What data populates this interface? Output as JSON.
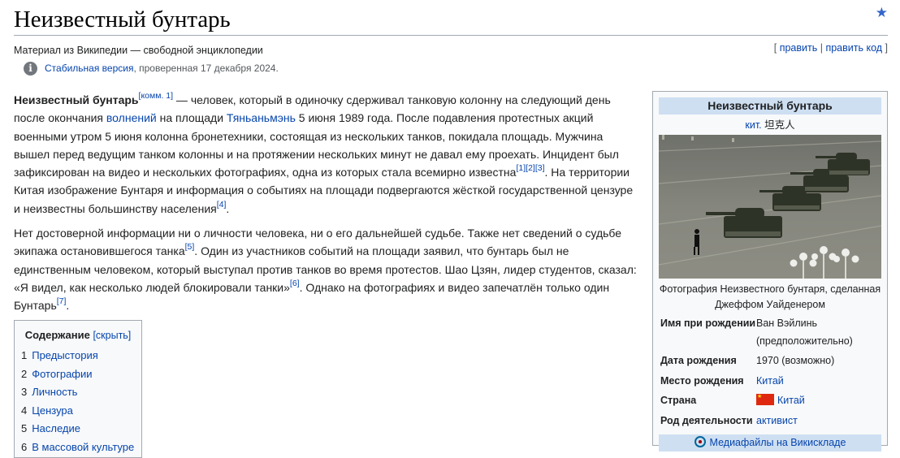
{
  "header": {
    "title": "Неизвестный бунтарь",
    "watch_icon": "star-icon",
    "tagline": "Материал из Википедии — свободной энциклопедии",
    "edit_links": {
      "open": "[ ",
      "edit": "править",
      "sep": " | ",
      "edit_code": "править код",
      "close": " ]"
    },
    "stable": {
      "link": "Стабильная версия",
      "text": ", проверенная 17 декабря 2024."
    }
  },
  "article": {
    "p1": {
      "bold": "Неизвестный бунтарь",
      "note": "[комм. 1]",
      "t1": " — человек, который в одиночку сдерживал танковую колонну на следующий день после окончания ",
      "link_unrest": "волнений",
      "t2": " на площади ",
      "link_square": "Тяньаньмэнь",
      "t3": " 5 июня 1989 года. После подавления протестных акций военными утром 5 июня колонна бронетехники, состоящая из нескольких танков, покидала площадь. Мужчина вышел перед ведущим танком колонны и на протяжении нескольких минут не давал ему проехать. Инцидент был зафиксирован на видео и нескольких фотографиях, одна из которых стала всемирно известна",
      "ref1": "[1]",
      "ref2": "[2]",
      "ref3": "[3]",
      "t4": ". На территории Китая изображение Бунтаря и информация о событиях на площади подвергаются жёсткой государственной цензуре и неизвестны большинству населения",
      "ref4": "[4]",
      "t5": "."
    },
    "p2": {
      "t1": "Нет достоверной информации ни о личности человека, ни о его дальнейшей судьбе. Также нет сведений о судьбе экипажа остановившегося танка",
      "ref5": "[5]",
      "t2": ". Один из участников событий на площади заявил, что бунтарь был не единственным человеком, который выступал против танков во время протестов. Шао Цзян, лидер студентов, сказал: «Я видел, как несколько людей блокировали танки»",
      "ref6": "[6]",
      "t3": ". Однако на фотографиях и видео запечатлён только один Бунтарь",
      "ref7": "[7]",
      "t4": "."
    }
  },
  "toc": {
    "title": "Содержание",
    "toggle": "[скрыть]",
    "items": [
      {
        "num": "1",
        "label": "Предыстория"
      },
      {
        "num": "2",
        "label": "Фотографии"
      },
      {
        "num": "3",
        "label": "Личность"
      },
      {
        "num": "4",
        "label": "Цензура"
      },
      {
        "num": "5",
        "label": "Наследие"
      },
      {
        "num": "6",
        "label": "В массовой культуре"
      }
    ]
  },
  "infobox": {
    "title": "Неизвестный бунтарь",
    "native_prefix": "кит.",
    "native_name": " 坦克人",
    "caption": "Фотография Неизвестного бунтаря, сделанная Джеффом Уайденером",
    "rows": [
      {
        "label": "Имя при рождении",
        "value": "Ван Вэйлинь (предположительно)"
      },
      {
        "label": "Дата рождения",
        "value": "1970 (возможно)"
      },
      {
        "label": "Место рождения",
        "value": "Китай"
      },
      {
        "label": "Страна",
        "value": "Китай"
      },
      {
        "label": "Род деятельности",
        "value": "активист"
      }
    ],
    "commons": "Медиафайлы на Викискладе",
    "colors": {
      "header_bg": "#cedff2",
      "link": "#0645ad",
      "flag_red": "#de2910",
      "flag_star": "#ffde00"
    }
  }
}
